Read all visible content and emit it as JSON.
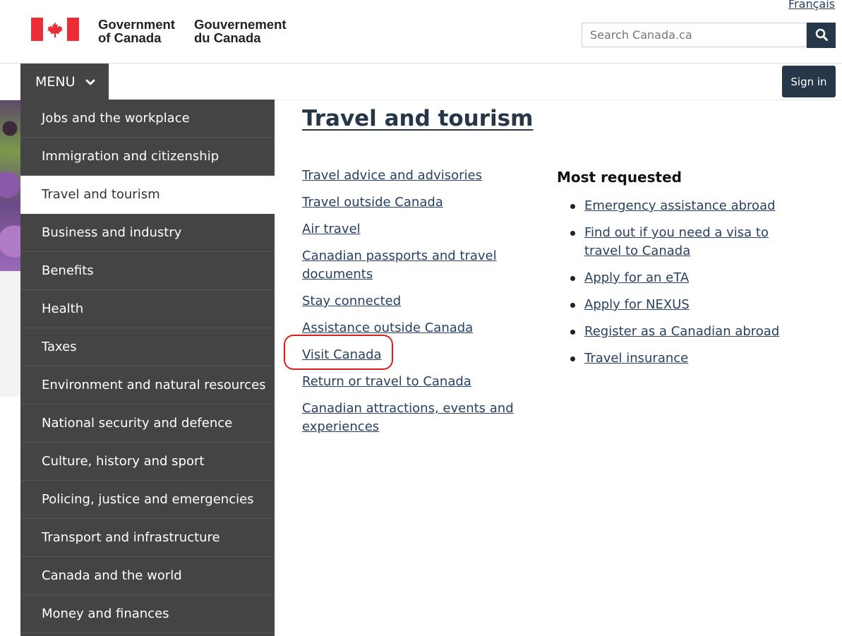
{
  "header": {
    "language_link": "Français",
    "wordmark_en": [
      "Government",
      "of Canada"
    ],
    "wordmark_fr": [
      "Gouvernement",
      "du Canada"
    ],
    "search_placeholder": "Search Canada.ca"
  },
  "menubar": {
    "menu_label": "MENU",
    "signin_label": "Sign in"
  },
  "menu": {
    "items": [
      {
        "label": "Jobs and the workplace"
      },
      {
        "label": "Immigration and citizenship"
      },
      {
        "label": "Travel and tourism"
      },
      {
        "label": "Business and industry"
      },
      {
        "label": "Benefits"
      },
      {
        "label": "Health"
      },
      {
        "label": "Taxes"
      },
      {
        "label": "Environment and natural resources"
      },
      {
        "label": "National security and defence"
      },
      {
        "label": "Culture, history and sport"
      },
      {
        "label": "Policing, justice and emergencies"
      },
      {
        "label": "Transport and infrastructure"
      },
      {
        "label": "Canada and the world"
      },
      {
        "label": "Money and finances"
      }
    ],
    "active_item": "Travel and tourism"
  },
  "main": {
    "title": "Travel and tourism",
    "links": [
      "Travel advice and advisories",
      "Travel outside Canada",
      "Air travel",
      "Canadian passports and travel documents",
      "Stay connected",
      "Assistance outside Canada",
      "Visit Canada",
      "Return or travel to Canada",
      "Canadian attractions, events and experiences"
    ],
    "most_requested_heading": "Most requested",
    "most_requested": [
      "Emergency assistance abroad",
      "Find out if you need a visa to travel to Canada",
      "Apply for an eTA",
      "Apply for NEXUS",
      "Register as a Canadian abroad",
      "Travel insurance"
    ]
  },
  "colors": {
    "flag_red": "#eb2d37",
    "menu_bg": "#444444",
    "header_dark": "#26374a",
    "link": "#284162",
    "highlight_ring": "#d52020"
  }
}
